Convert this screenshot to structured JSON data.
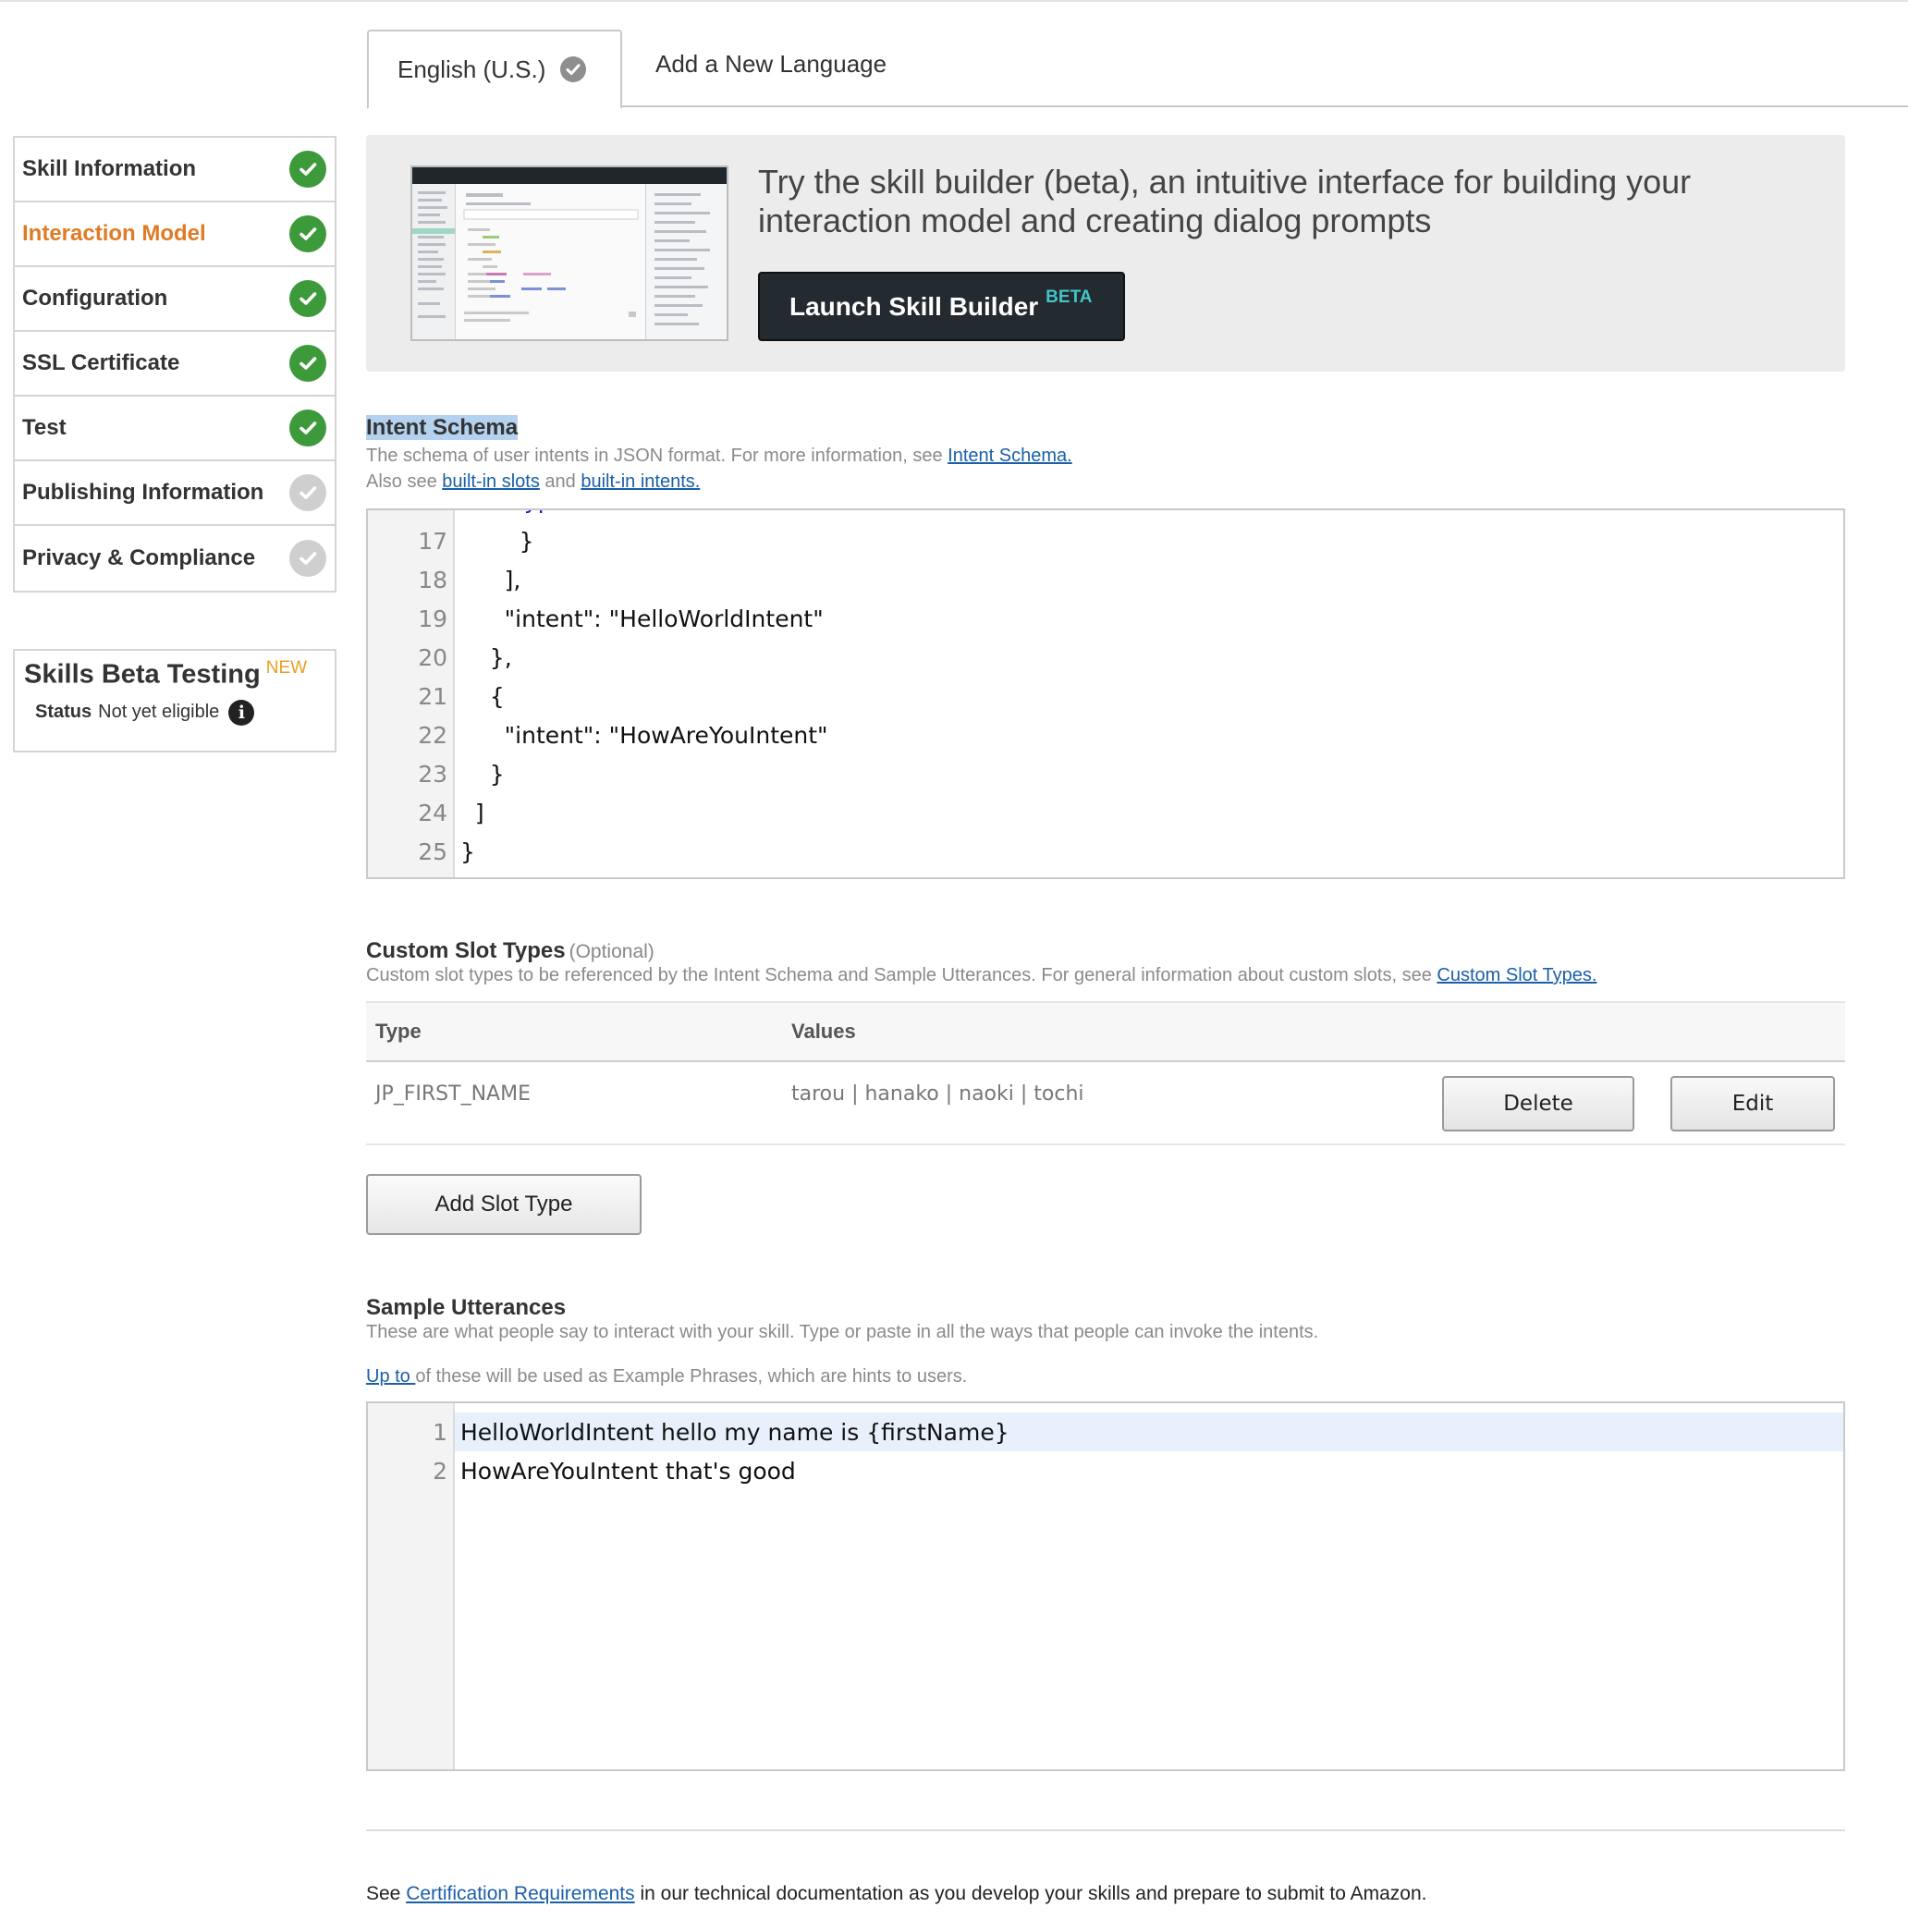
{
  "tabs": {
    "active_label": "English (U.S.)",
    "add_label": "Add a New Language"
  },
  "sidebar": {
    "items": [
      {
        "label": "Skill Information",
        "status": "complete"
      },
      {
        "label": "Interaction Model",
        "status": "complete",
        "active": true
      },
      {
        "label": "Configuration",
        "status": "complete"
      },
      {
        "label": "SSL Certificate",
        "status": "complete"
      },
      {
        "label": "Test",
        "status": "complete"
      },
      {
        "label": "Publishing Information",
        "status": "incomplete"
      },
      {
        "label": "Privacy & Compliance",
        "status": "incomplete"
      }
    ]
  },
  "beta_testing": {
    "title": "Skills Beta Testing",
    "badge": "NEW",
    "status_label": "Status",
    "status_value": "Not yet eligible"
  },
  "promo": {
    "text": "Try the skill builder (beta), an intuitive interface for building your interaction model and creating dialog prompts",
    "button_label": "Launch Skill Builder",
    "button_badge": "BETA"
  },
  "intent_schema": {
    "title": "Intent Schema",
    "desc_1": "The schema of user intents in JSON format. For more information, see ",
    "link_1": "Intent Schema.",
    "desc_2": "Also see ",
    "link_2": "built-in slots",
    "desc_3": " and ",
    "link_3": "built-in intents.",
    "lines": [
      {
        "n": "17",
        "text": "        }"
      },
      {
        "n": "18",
        "text": "      ],"
      },
      {
        "n": "19",
        "text": "      \"intent\": \"HelloWorldIntent\""
      },
      {
        "n": "20",
        "text": "    },"
      },
      {
        "n": "21",
        "text": "    {"
      },
      {
        "n": "22",
        "text": "      \"intent\": \"HowAreYouIntent\""
      },
      {
        "n": "23",
        "text": "    }"
      },
      {
        "n": "24",
        "text": "  ]"
      },
      {
        "n": "25",
        "text": "}"
      }
    ]
  },
  "custom_slots": {
    "title": "Custom Slot Types",
    "optional": "(Optional)",
    "desc": "Custom slot types to be referenced by the Intent Schema and Sample Utterances. For general information about custom slots, see ",
    "link": "Custom Slot Types.",
    "col_type": "Type",
    "col_values": "Values",
    "rows": [
      {
        "type": "JP_FIRST_NAME",
        "values": "tarou | hanako | naoki | tochi"
      }
    ],
    "delete_label": "Delete",
    "edit_label": "Edit",
    "add_label": "Add Slot Type"
  },
  "sample_utterances": {
    "title": "Sample Utterances",
    "desc": "These are what people say to interact with your skill. Type or paste in all the ways that people can invoke the intents.",
    "hint_link": "Up to ",
    "hint_text": "of these will be used as Example Phrases, which are hints to users.",
    "lines": [
      {
        "n": "1",
        "text": "HelloWorldIntent hello my name is {firstName}"
      },
      {
        "n": "2",
        "text": "HowAreYouIntent that's good"
      }
    ]
  },
  "footer": {
    "pre": "See ",
    "link": "Certification Requirements",
    "post": " in our technical documentation as you develop your skills and prepare to submit to Amazon."
  },
  "colors": {
    "accent": "#e07b25",
    "complete": "#3d9a3b",
    "incomplete": "#cfcfcf",
    "link": "#1a5fa8",
    "json_string": "#1a1acc"
  }
}
